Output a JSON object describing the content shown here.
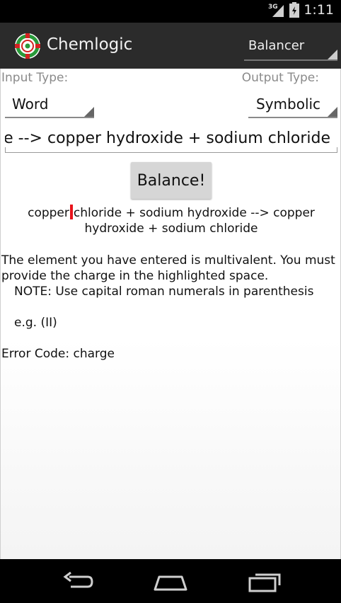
{
  "status_bar": {
    "time": "1:11",
    "network": "3G"
  },
  "action_bar": {
    "app_title": "Chemlogic",
    "mode_spinner": "Balancer"
  },
  "form": {
    "input_type_label": "Input Type:",
    "output_type_label": "Output Type:",
    "input_type_value": "Word",
    "output_type_value": "Symbolic",
    "equation_field_value": "copper chloride + sodium hydroxide --> copper hydroxide + sodium chloride",
    "equation_field_visible": "de --> copper hydroxide + sodium chloride",
    "balance_button": "Balance!"
  },
  "result": {
    "equation_before_highlight": "copper",
    "equation_after_highlight": "chloride + sodium hydroxide --> copper hydroxide + sodium chloride",
    "message_line1": "The element you have entered is multivalent. You must",
    "message_line2": "provide the charge in the highlighted space.",
    "note": "NOTE: Use capital roman numerals in parenthesis",
    "example": "e.g. (II)",
    "error_code": "Error Code: charge"
  },
  "nav_bar": {
    "icons": [
      "back-icon",
      "home-icon",
      "recent-apps-icon"
    ]
  },
  "colors": {
    "highlight": "#e8141c",
    "action_bar": "#2b2b2b"
  }
}
